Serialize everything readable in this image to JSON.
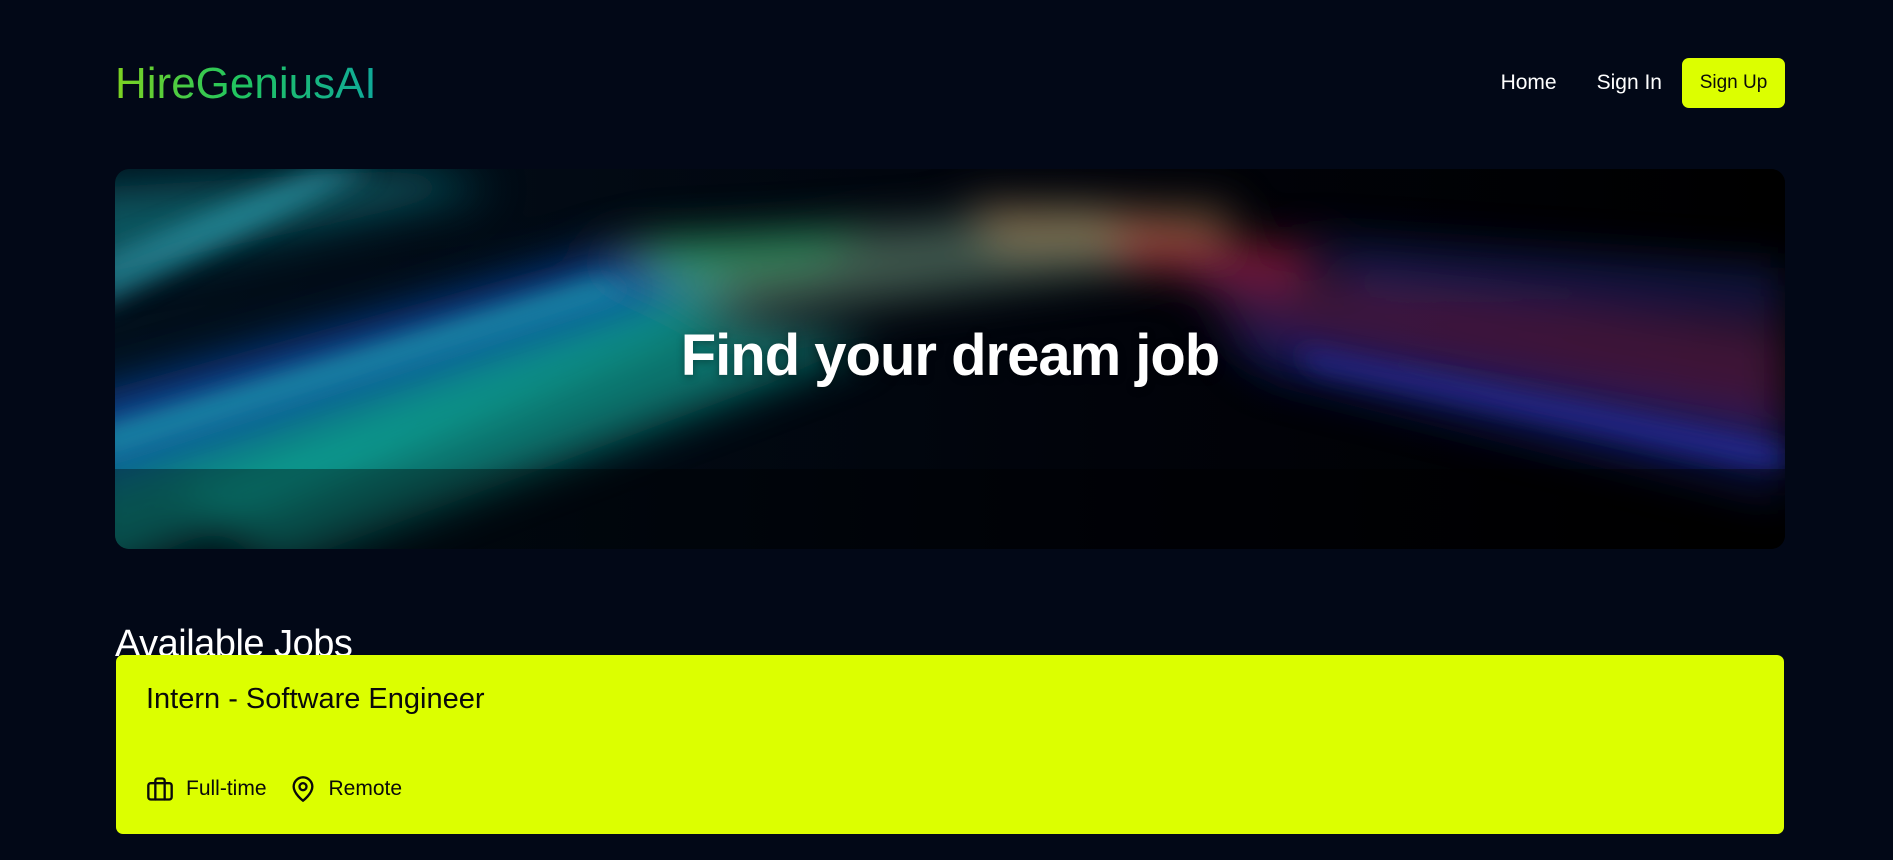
{
  "header": {
    "logo": "HireGeniusAI",
    "nav": {
      "home": "Home",
      "sign_in": "Sign In",
      "sign_up": "Sign Up"
    }
  },
  "hero": {
    "title": "Find your dream job"
  },
  "jobs_section": {
    "title": "Available Jobs",
    "jobs": [
      {
        "title": "Intern - Software Engineer",
        "type": "Full-time",
        "location": "Remote",
        "type_icon": "briefcase-icon",
        "location_icon": "map-pin-icon"
      }
    ]
  },
  "colors": {
    "background": "#020817",
    "accent": "#dcff00",
    "logo_gradient_start": "#7ed321",
    "logo_gradient_end": "#0fa99a"
  }
}
